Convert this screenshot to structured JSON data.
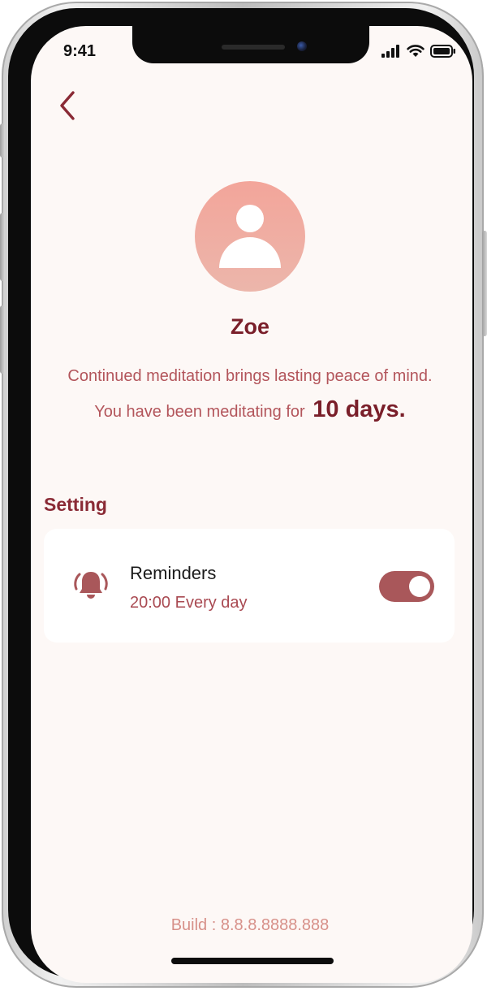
{
  "status_bar": {
    "time": "9:41"
  },
  "navigation": {
    "back_icon": "chevron-left-icon"
  },
  "profile": {
    "avatar_icon": "user-avatar-icon",
    "name": "Zoe",
    "quote": "Continued meditation brings lasting peace of mind.",
    "streak_prefix": "You have been meditating for",
    "streak_days": "10 days."
  },
  "settings": {
    "section_title": "Setting",
    "reminders": {
      "icon": "bell-ringing-icon",
      "title": "Reminders",
      "schedule": "20:00 Every day",
      "enabled": true
    }
  },
  "footer": {
    "build": "Build : 8.8.8.8888.888"
  },
  "colors": {
    "background": "#fdf8f6",
    "accent_dark": "#7a1f2a",
    "accent": "#b3555b",
    "toggle": "#a9575a",
    "avatar_gradient_top": "#f3a59a",
    "build_text": "#d79089"
  }
}
